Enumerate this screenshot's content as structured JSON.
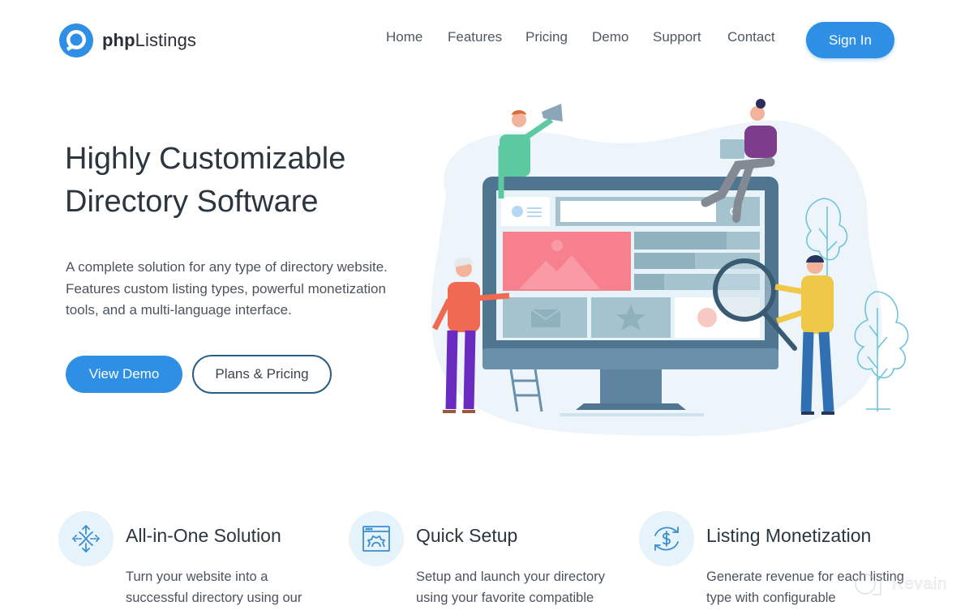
{
  "header": {
    "logo": {
      "brand_bold": "php",
      "brand_regular": "Listings",
      "icon": "search-ring-icon"
    },
    "nav": [
      {
        "label": "Home"
      },
      {
        "label": "Features"
      },
      {
        "label": "Pricing"
      },
      {
        "label": "Demo"
      },
      {
        "label": "Support"
      },
      {
        "label": "Contact"
      }
    ],
    "signin_label": "Sign In"
  },
  "hero": {
    "title_line1": "Highly Customizable",
    "title_line2": "Directory Software",
    "description": "A complete solution for any type of directory website. Features custom listing types, powerful monetization tools, and a multi-language interface.",
    "primary_button": "View Demo",
    "secondary_button": "Plans & Pricing",
    "illustration": "people-around-monitor-with-directory-website"
  },
  "features": [
    {
      "icon": "arrows-expand-icon",
      "title": "All-in-One Solution",
      "description": "Turn your website into a successful directory using our"
    },
    {
      "icon": "browser-gear-icon",
      "title": "Quick Setup",
      "description": "Setup and launch your directory using your favorite compatible"
    },
    {
      "icon": "dollar-cycle-icon",
      "title": "Listing Monetization",
      "description": "Generate revenue for each listing type with configurable"
    }
  ],
  "watermark": {
    "label": "Revain"
  },
  "colors": {
    "accent": "#2f8fe5",
    "outline_border": "#2c5d85",
    "heading": "#2b3640",
    "body_text": "#4b545c",
    "feature_icon_bg": "#e6f3fb",
    "monitor_frame": "#4f7590",
    "hero_image_red": "#f7808f"
  }
}
